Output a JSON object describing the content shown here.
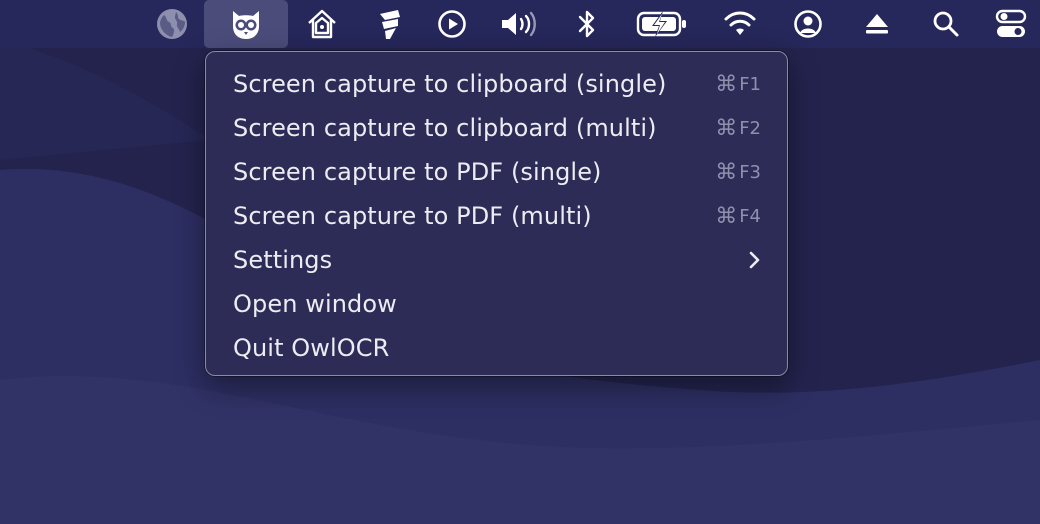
{
  "menubar": {
    "items": [
      {
        "name": "globe-icon"
      },
      {
        "name": "owlocr-icon",
        "active": true
      },
      {
        "name": "home-icon"
      },
      {
        "name": "app-s-icon"
      },
      {
        "name": "play-icon"
      },
      {
        "name": "volume-icon"
      },
      {
        "name": "bluetooth-icon"
      },
      {
        "name": "battery-charging-icon"
      },
      {
        "name": "wifi-icon"
      },
      {
        "name": "user-icon"
      },
      {
        "name": "eject-icon"
      },
      {
        "name": "search-icon"
      },
      {
        "name": "control-center-icon"
      }
    ]
  },
  "menu": {
    "items": [
      {
        "label": "Screen capture to clipboard (single)",
        "shortcut_symbol": "⌘",
        "shortcut_key": "F1"
      },
      {
        "label": "Screen capture to clipboard (multi)",
        "shortcut_symbol": "⌘",
        "shortcut_key": "F2"
      },
      {
        "label": "Screen capture to PDF (single)",
        "shortcut_symbol": "⌘",
        "shortcut_key": "F3"
      },
      {
        "label": "Screen capture to PDF (multi)",
        "shortcut_symbol": "⌘",
        "shortcut_key": "F4"
      },
      {
        "label": "Settings",
        "has_submenu": true,
        "arrow_icon": "chevron-right-icon"
      },
      {
        "label": "Open window"
      },
      {
        "label": "Quit OwlOCR"
      }
    ]
  },
  "colors": {
    "menubar_bg": "#26275a",
    "desktop_bg": "#23234e",
    "menu_bg": "#2c2c57",
    "menu_text": "#ececf2",
    "shortcut_text": "#8f8fae",
    "active_icon_bg": "#4b4c7a"
  }
}
